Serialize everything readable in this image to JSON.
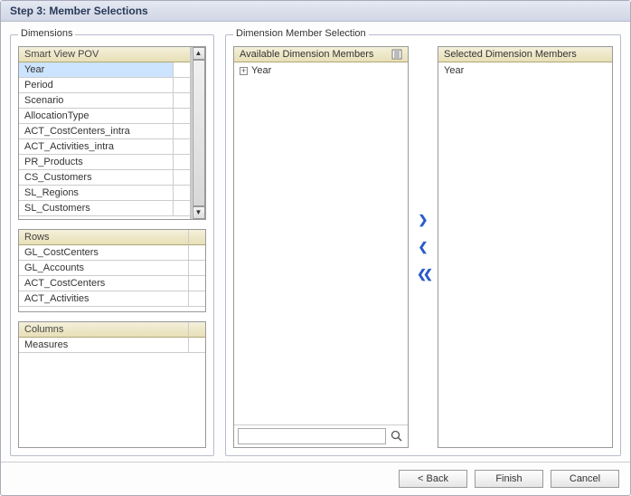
{
  "title": "Step 3: Member Selections",
  "dimensions": {
    "label": "Dimensions",
    "pov": {
      "header": "Smart View POV",
      "items": [
        "Year",
        "Period",
        "Scenario",
        "AllocationType",
        "ACT_CostCenters_intra",
        "ACT_Activities_intra",
        "PR_Products",
        "CS_Customers",
        "SL_Regions",
        "SL_Customers"
      ],
      "selected_index": 0
    },
    "rows": {
      "header": "Rows",
      "items": [
        "GL_CostCenters",
        "GL_Accounts",
        "ACT_CostCenters",
        "ACT_Activities"
      ]
    },
    "columns": {
      "header": "Columns",
      "items": [
        "Measures"
      ]
    }
  },
  "member_selection": {
    "label": "Dimension Member Selection",
    "available": {
      "header": "Available Dimension Members",
      "root": "Year"
    },
    "selected": {
      "header": "Selected Dimension Members",
      "items": [
        "Year"
      ]
    },
    "search_placeholder": ""
  },
  "buttons": {
    "back": "< Back",
    "finish": "Finish",
    "cancel": "Cancel"
  },
  "icons": {
    "expand": "+",
    "move_right": "❯",
    "move_left": "❮",
    "move_all_left": "❮❮"
  }
}
